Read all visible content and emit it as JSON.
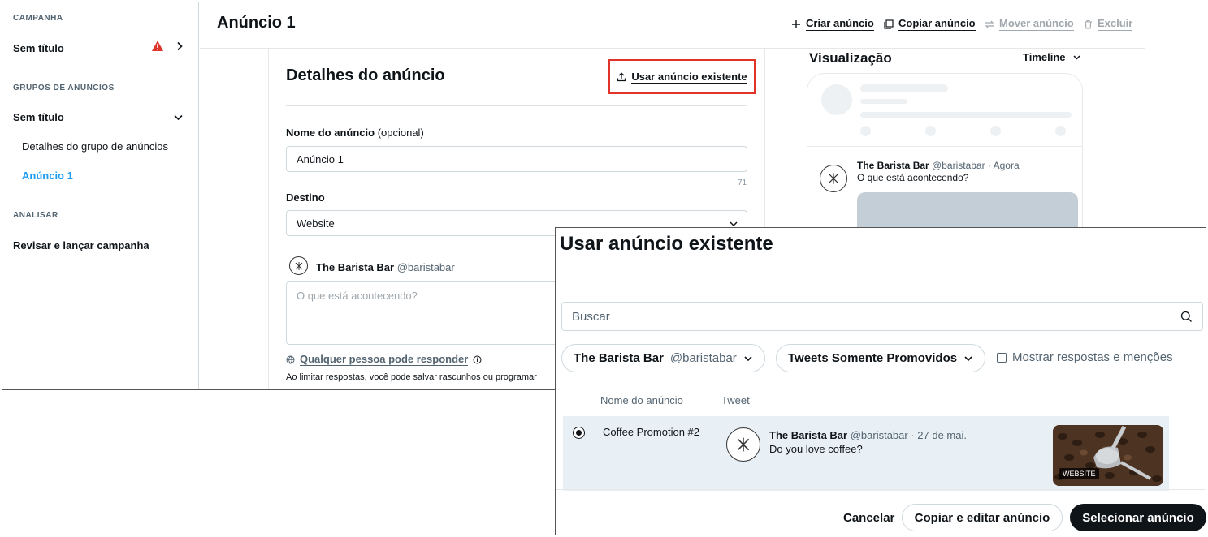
{
  "sidebar": {
    "campaign_section": "CAMPANHA",
    "campaign_item": "Sem título",
    "adgroups_section": "GRUPOS DE ANUNCIOS",
    "adgroup_item": "Sem título",
    "adgroup_details": "Detalhes do grupo de anúncios",
    "ad_item": "Anúncio 1",
    "analyze_section": "ANALISAR",
    "review_item": "Revisar e lançar campanha"
  },
  "header": {
    "title": "Anúncio 1",
    "create_ad": "Criar anúncio",
    "copy_ad": "Copiar anúncio",
    "move_ad": "Mover anúncio",
    "delete": "Excluir"
  },
  "details": {
    "title": "Detalhes do anúncio",
    "use_existing": "Usar anúncio existente",
    "name_label": "Nome do anúncio",
    "name_optional": "(opcional)",
    "name_value": "Anúncio 1",
    "name_counter": "71",
    "destination_label": "Destino",
    "destination_value": "Website",
    "account_name": "The Barista Bar",
    "account_handle": "@baristabar",
    "tweet_placeholder": "O que está acontecendo?",
    "reply_setting": "Qualquer pessoa pode responder",
    "reply_hint": "Ao limitar respostas, você pode salvar rascunhos ou programar"
  },
  "preview": {
    "title": "Visualização",
    "mode": "Timeline",
    "account_name": "The Barista Bar",
    "account_meta": "@baristabar · Agora",
    "text": "O que está acontecendo?"
  },
  "modal": {
    "title": "Usar anúncio existente",
    "search_placeholder": "Buscar",
    "account_filter_name": "The Barista Bar",
    "account_filter_handle": "@baristabar",
    "type_filter": "Tweets Somente Promovidos",
    "show_replies": "Mostrar respostas e menções",
    "col_name": "Nome do anúncio",
    "col_tweet": "Tweet",
    "rows": [
      {
        "name": "Coffee Promotion #2",
        "account": "The Barista Bar",
        "meta": "@baristabar · 27 de mai.",
        "text": "Do you love coffee?",
        "badge": "WEBSITE"
      }
    ],
    "cancel": "Cancelar",
    "copy_edit": "Copiar e editar anúncio",
    "select": "Selecionar anúncio"
  },
  "colors": {
    "accent": "#1d9bf0",
    "warning": "#e0332a",
    "primary_button": "#0f1419"
  }
}
